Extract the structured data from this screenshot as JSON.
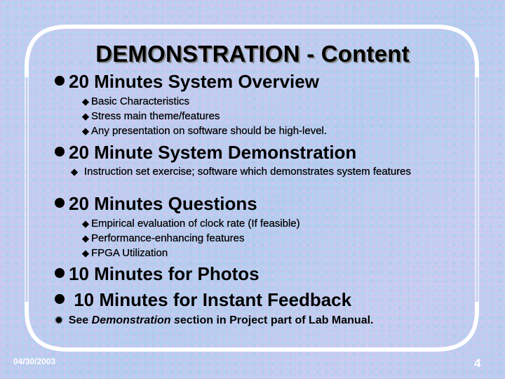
{
  "slide": {
    "title": "DEMONSTRATION - Content",
    "sections": [
      {
        "heading": "20 Minutes System Overview",
        "items": [
          "Basic Characteristics",
          "Stress main theme/features",
          "Any presentation on software should be high-level."
        ]
      },
      {
        "heading": "20 Minute System Demonstration",
        "items": [
          "Instruction set exercise; software which demonstrates system features"
        ]
      },
      {
        "heading": "20 Minutes Questions",
        "items": [
          "Empirical evaluation of clock rate (If feasible)",
          "Performance-enhancing features",
          "FPGA Utilization"
        ]
      },
      {
        "heading": "10 Minutes for Photos",
        "items": []
      },
      {
        "heading": " 10 Minutes for Instant Feedback",
        "items": []
      }
    ],
    "note": {
      "prefix": "See ",
      "emphasis": "Demonstration s",
      "suffix": "ection in Project part of Lab Manual."
    },
    "icons": {
      "level1": "filled-circle-bullet",
      "level2": "diamond-bullet",
      "note": "star-burst-bullet"
    },
    "footer": {
      "date": "04/30/2003",
      "page_number": "4"
    },
    "colors": {
      "text": "#000000",
      "frame": "#ffffff",
      "footer_text": "#ffffff",
      "background": "#b8cdf0",
      "title_shadow": "#8a8a8a"
    }
  }
}
